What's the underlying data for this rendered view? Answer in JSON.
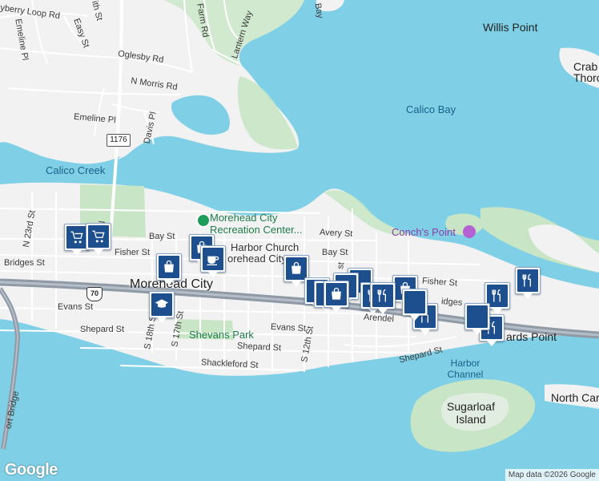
{
  "map": {
    "water_labels": [
      "Calico Bay",
      "Calico Creek",
      "Harbor Channel"
    ],
    "place_labels": [
      "Willis Point",
      "Conch's Point",
      "Crab",
      "Thoro",
      "North Caro",
      "ards Point"
    ],
    "island_labels": [
      "Sugarloaf Island"
    ],
    "city_label": "Morehead City",
    "poi_labels": {
      "recreation_center": "Morehead City Recreation Center...",
      "harbor_church": "Harbor Church",
      "harbor_church_sub": "orehead City",
      "park": "Shevans Park"
    },
    "road_labels": {
      "mayberry_loop": "yberry Loop Rd",
      "easy_st": "Easy St",
      "oglesby_rd": "Oglesby Rd",
      "n_morris_rd": "N Morris Rd",
      "emeline_pl": "Emeline Pl",
      "davis_pl": "Davis Pl",
      "farm_rd": "Farm Rd",
      "lantern_way": "Lantern Way",
      "arendell_north": "ith St",
      "bay_st_w": "Bay St",
      "bay_st_e": "Bay St",
      "avery_st": "Avery St",
      "fisher_st_w": "Fisher St",
      "fisher_st_e": "Fisher St",
      "bridges_st": "Bridges St",
      "bridges_st_e": "idges",
      "evans_st_w": "Evans St",
      "evans_st_e": "Evans St",
      "shepard_st_w": "Shepard St",
      "shepard_st_c": "Shepard St",
      "shepard_st_e": "Shepard St",
      "shackleford_st": "Shackleford St",
      "arendell_st": "Arendel",
      "n_23rd_st": "N 23rd St",
      "s_18th_st": "S 18th St",
      "s_17th_st": "S 17th St",
      "s_12th_st": "S 12th St",
      "n_st": "N",
      "emeline_w": "Emeline Pl",
      "bridge": "ort Bridge",
      "twelfth_st": "st",
      "mayberry_small": "Bay"
    },
    "route_shields": [
      "1176",
      "70"
    ],
    "marker_icons": [
      "shopping-cart-icon",
      "shopping-cart-icon",
      "shopping-bag-icon",
      "coffee-cup-icon",
      "shopping-bag-icon",
      "shopping-bag-icon",
      "graduation-cap-icon",
      "shopping-bag-icon",
      "restaurant-icon",
      "restaurant-icon",
      "restaurant-icon",
      "restaurant-icon",
      "restaurant-icon",
      "restaurant-icon"
    ],
    "colors": {
      "water": "#7fd0e6",
      "land": "#f2f2f2",
      "green": "#c8e6c5",
      "highway": "#8f9aa6",
      "marker": "#1d4f8f"
    }
  },
  "footer": {
    "logo": "Google",
    "attribution": "Map data ©2026 Google"
  }
}
